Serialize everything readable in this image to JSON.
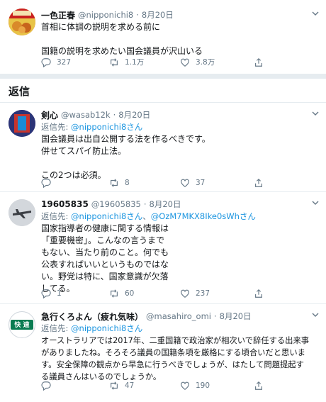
{
  "tweets": [
    {
      "name": "一色正春",
      "handle": "@nipponichi8",
      "date": "8月20日",
      "reply_to": "",
      "text": "首相に体調の説明を求める前に\n\n国籍の説明を求めたい国会議員が沢山いる",
      "replies": "327",
      "retweets": "1.1万",
      "likes": "3.8万"
    },
    {
      "name": "剣心",
      "handle": "@wasab12k",
      "date": "8月20日",
      "reply_prefix": "返信先: ",
      "reply_to": "@nipponichi8さん",
      "reply_to2": "",
      "text": "国会議員は出自公開する法を作るべきです。\n併せてスパイ防止法。\n\nこの2つは必須。",
      "replies": "",
      "retweets": "8",
      "likes": "37"
    },
    {
      "name": "19605835",
      "handle": "@19605835",
      "date": "8月20日",
      "reply_prefix": "返信先: ",
      "reply_to": "@nipponichi8さん",
      "reply_sep": "、",
      "reply_to2": "@OzM7MKX8Ike0sWhさん",
      "text": "国家指導者の健康に関する情報は\n「重要機密」。こんなの言うまで\nもない、当たり前のこと。何でも\n公表すればいいというものではな\nい。野党は特に、国家意識が欠落\nしてる。",
      "replies": "1",
      "retweets": "60",
      "likes": "237"
    },
    {
      "name": "急行くろよん（疲れ気味）",
      "handle": "@masahiro_omi",
      "date": "8月20日",
      "reply_prefix": "返信先: ",
      "reply_to": "@nipponichi8さん",
      "reply_to2": "",
      "text": "オーストラリアでは2017年、二重国籍で政治家が相次いで辞任する出来事\nがありましたね。そろそろ議員の国籍条項を厳格にする頃合いだと思いま\nす。安全保障の観点から早急に行うべきでしょうが、はたして問題提起す\nる議員さんはいるのでしょうか。",
      "replies": "",
      "retweets": "47",
      "likes": "190"
    }
  ],
  "section_title": "返信",
  "dot": "·",
  "avatar4_text": "快 速",
  "colors": {
    "link": "#1b95e0",
    "muted": "#657786",
    "divider": "#e6ecf0"
  }
}
